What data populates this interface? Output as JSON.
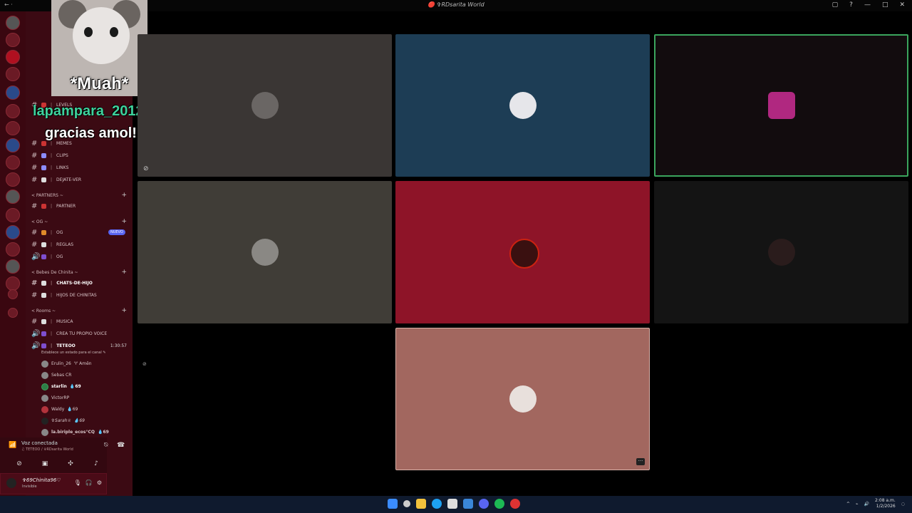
{
  "window": {
    "title": "🔴 ✞RDsarita World",
    "left_hint": "← ·",
    "controls": [
      "▢",
      "?",
      "—",
      "□",
      "✕"
    ]
  },
  "overlay": {
    "caption": "*Muah*",
    "username": "lapampara_2012",
    "message": "gracias amol!"
  },
  "channels": {
    "items": [
      {
        "name": "LEVELS"
      },
      {
        "name": "MEMES"
      },
      {
        "name": "CLIPS"
      },
      {
        "name": "LINKS"
      },
      {
        "name": "DEJATE-VER"
      }
    ],
    "partners_category": "< PARTNERS ~",
    "partner_channel": "PARTNER",
    "og_category": "< OG ~",
    "og_channels": [
      "OG",
      "REGLAS",
      "OG"
    ],
    "nuevo_badge": "NUEVO",
    "bebes_category": "< Bebes De Chinita ~",
    "bebes_channels": [
      "CHATS-DE-HIJO",
      "HIJOS DE CHINITAS"
    ],
    "rooms_category": "< Rooms ~",
    "rooms_channels": [
      "MUSICA",
      "CREA TU PROPIO VOICE"
    ],
    "active_voice": {
      "name": "TETEOO",
      "timer": "1:30:57",
      "status_prompt": "Establece un estado para el canal ✎"
    },
    "voice_users": [
      {
        "name": "Erulin_26",
        "tag": "♈ Amên"
      },
      {
        "name": "Sebas CR",
        "tag": ""
      },
      {
        "name": "starlin",
        "tag": "💧69"
      },
      {
        "name": "VictorRP",
        "tag": ""
      },
      {
        "name": "Waldy",
        "tag": "💧69"
      },
      {
        "name": "✞Sarah♕",
        "tag": "💧69"
      },
      {
        "name": "la.biriple_ecos°CQ",
        "tag": "💧69"
      }
    ]
  },
  "voice_connection": {
    "title": "Voz conectada",
    "subtitle": "♫ TETEOO / ✞RDsarita World"
  },
  "user_panel": {
    "name": "✞69Chinita96♡",
    "status": "Invisible"
  },
  "taskbar": {
    "time": "2:08 a.m.",
    "date": "1/2/2026"
  }
}
